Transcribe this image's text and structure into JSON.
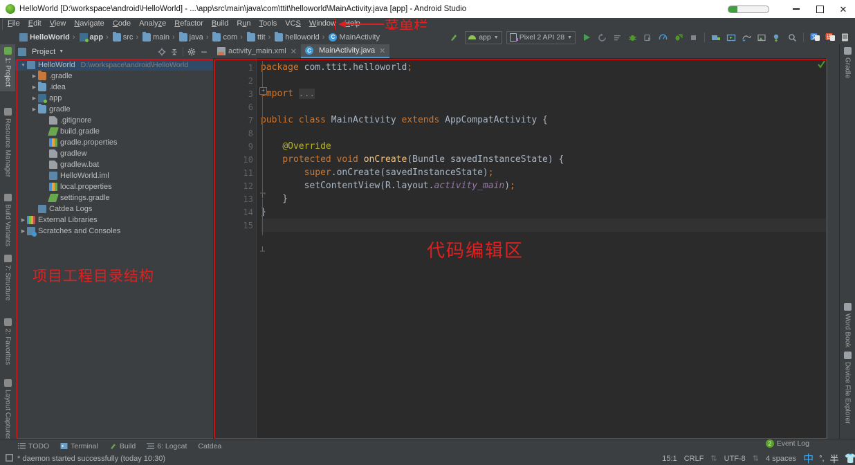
{
  "window": {
    "title": "HelloWorld [D:\\workspace\\android\\HelloWorld] - ...\\app\\src\\main\\java\\com\\ttit\\helloworld\\MainActivity.java [app] - Android Studio",
    "app_icon": "android-studio-icon",
    "minimize_label": "—",
    "maximize_label": "❐",
    "close_label": "✕",
    "progress_percent": 22
  },
  "menubar": {
    "items": [
      {
        "label": "File",
        "mnemonic": "F"
      },
      {
        "label": "Edit",
        "mnemonic": "E"
      },
      {
        "label": "View",
        "mnemonic": "V"
      },
      {
        "label": "Navigate",
        "mnemonic": "N"
      },
      {
        "label": "Code",
        "mnemonic": "C"
      },
      {
        "label": "Analyze",
        "mnemonic": "z"
      },
      {
        "label": "Refactor",
        "mnemonic": "R"
      },
      {
        "label": "Build",
        "mnemonic": "B"
      },
      {
        "label": "Run",
        "mnemonic": "u"
      },
      {
        "label": "Tools",
        "mnemonic": "T"
      },
      {
        "label": "VCS",
        "mnemonic": "S"
      },
      {
        "label": "Window",
        "mnemonic": "W"
      },
      {
        "label": "Help",
        "mnemonic": "H"
      }
    ]
  },
  "breadcrumb": {
    "items": [
      {
        "label": "HelloWorld",
        "icon": "project-icon",
        "bold": true
      },
      {
        "label": "app",
        "icon": "module-icon",
        "bold": true
      },
      {
        "label": "src",
        "icon": "folder-icon",
        "bold": false
      },
      {
        "label": "main",
        "icon": "folder-icon",
        "bold": false
      },
      {
        "label": "java",
        "icon": "folder-icon",
        "bold": false
      },
      {
        "label": "com",
        "icon": "package-icon",
        "bold": false
      },
      {
        "label": "ttit",
        "icon": "package-icon",
        "bold": false
      },
      {
        "label": "helloworld",
        "icon": "package-icon",
        "bold": false
      },
      {
        "label": "MainActivity",
        "icon": "class-icon",
        "bold": false
      }
    ],
    "separator": "›"
  },
  "toolbar": {
    "build_icon": "hammer-icon",
    "run_config": {
      "label": "app",
      "icon": "android-icon",
      "caret": "▼"
    },
    "device": {
      "label": "Pixel 2 API 28",
      "icon": "device-icon",
      "caret": "▼"
    },
    "actions": [
      {
        "name": "run-icon",
        "glyph": "▶"
      },
      {
        "name": "apply-changes-icon",
        "glyph": "⟲"
      },
      {
        "name": "apply-code-changes-icon",
        "glyph": "≡"
      },
      {
        "name": "debug-icon",
        "glyph": "🐞"
      },
      {
        "name": "attach-debugger-icon",
        "glyph": "⬓"
      },
      {
        "name": "profiler-icon",
        "glyph": "◔"
      },
      {
        "name": "run-with-coverage-icon",
        "glyph": "⬔"
      },
      {
        "name": "stop-icon",
        "glyph": "■"
      },
      {
        "name": "avd-manager-icon",
        "glyph": "▤"
      },
      {
        "name": "sdk-manager-icon",
        "glyph": "▣"
      },
      {
        "name": "sync-gradle-icon",
        "glyph": "⟳"
      },
      {
        "name": "project-structure-icon",
        "glyph": "◫"
      },
      {
        "name": "layout-inspector-icon",
        "glyph": "⬓"
      },
      {
        "name": "search-everywhere-icon",
        "glyph": "⌕"
      },
      {
        "name": "translate-icon-1",
        "glyph": "文"
      },
      {
        "name": "translate-icon-2",
        "glyph": "译"
      },
      {
        "name": "device-manager-icon",
        "glyph": "▯"
      }
    ]
  },
  "left_tool_strip": {
    "tabs": [
      {
        "label": "1: Project",
        "icon": "project-tool-icon",
        "active": true
      },
      {
        "label": "Resource Manager",
        "icon": "resource-manager-icon",
        "active": false
      },
      {
        "label": "Build Variants",
        "icon": "build-variants-icon",
        "active": false
      },
      {
        "label": "7: Structure",
        "icon": "structure-icon",
        "active": false
      },
      {
        "label": "2: Favorites",
        "icon": "favorites-star-icon",
        "active": false
      },
      {
        "label": "Layout Captures",
        "icon": "layout-captures-icon",
        "active": false
      }
    ]
  },
  "right_tool_strip": {
    "tabs": [
      {
        "label": "Gradle",
        "icon": "gradle-elephant-icon"
      },
      {
        "label": "Word Book",
        "icon": "word-book-icon"
      },
      {
        "label": "Device File Explorer",
        "icon": "device-file-explorer-icon"
      }
    ]
  },
  "project_panel": {
    "title": "Project",
    "title_icon": "project-view-icon",
    "caret": "▼",
    "header_actions": [
      {
        "name": "locate-icon",
        "glyph": "⊕"
      },
      {
        "name": "collapse-all-icon",
        "glyph": "⇱"
      },
      {
        "name": "settings-gear-icon",
        "glyph": "⚙"
      },
      {
        "name": "hide-panel-icon",
        "glyph": "—"
      }
    ],
    "tree": [
      {
        "label": "HelloWorld",
        "path": "D:\\workspace\\android\\HelloWorld",
        "indent": 0,
        "arrow": "▼",
        "icon": "project-icon",
        "selected": true
      },
      {
        "label": ".gradle",
        "path": "",
        "indent": 1,
        "arrow": "▶",
        "icon": "folder-orange-icon",
        "selected": false
      },
      {
        "label": ".idea",
        "path": "",
        "indent": 1,
        "arrow": "▶",
        "icon": "folder-icon",
        "selected": false
      },
      {
        "label": "app",
        "path": "",
        "indent": 1,
        "arrow": "▶",
        "icon": "module-icon",
        "selected": false
      },
      {
        "label": "gradle",
        "path": "",
        "indent": 1,
        "arrow": "▶",
        "icon": "folder-icon",
        "selected": false
      },
      {
        "label": ".gitignore",
        "path": "",
        "indent": 2,
        "arrow": "",
        "icon": "file-icon",
        "selected": false
      },
      {
        "label": "build.gradle",
        "path": "",
        "indent": 2,
        "arrow": "",
        "icon": "gradle-file-icon",
        "selected": false
      },
      {
        "label": "gradle.properties",
        "path": "",
        "indent": 2,
        "arrow": "",
        "icon": "properties-file-icon",
        "selected": false
      },
      {
        "label": "gradlew",
        "path": "",
        "indent": 2,
        "arrow": "",
        "icon": "file-icon",
        "selected": false
      },
      {
        "label": "gradlew.bat",
        "path": "",
        "indent": 2,
        "arrow": "",
        "icon": "file-icon",
        "selected": false
      },
      {
        "label": "HelloWorld.iml",
        "path": "",
        "indent": 2,
        "arrow": "",
        "icon": "iml-file-icon",
        "selected": false
      },
      {
        "label": "local.properties",
        "path": "",
        "indent": 2,
        "arrow": "",
        "icon": "properties-file-icon",
        "selected": false
      },
      {
        "label": "settings.gradle",
        "path": "",
        "indent": 2,
        "arrow": "",
        "icon": "gradle-file-icon",
        "selected": false
      },
      {
        "label": "Catdea Logs",
        "path": "",
        "indent": 1,
        "arrow": "",
        "icon": "catdea-logs-icon",
        "selected": false
      },
      {
        "label": "External Libraries",
        "path": "",
        "indent": 0,
        "arrow": "▶",
        "icon": "external-libraries-icon",
        "selected": false
      },
      {
        "label": "Scratches and Consoles",
        "path": "",
        "indent": 0,
        "arrow": "▶",
        "icon": "scratches-icon",
        "selected": false
      }
    ]
  },
  "editor": {
    "tabs": [
      {
        "label": "activity_main.xml",
        "icon": "xml-layout-icon",
        "active": false,
        "close": "✕"
      },
      {
        "label": "MainActivity.java",
        "icon": "java-class-icon",
        "active": true,
        "close": "✕"
      }
    ],
    "gutter_numbers": [
      "1",
      "2",
      "3",
      "6",
      "7",
      "8",
      "9",
      "10",
      "11",
      "12",
      "13",
      "14",
      "15"
    ],
    "lines": [
      {
        "num": "1",
        "text": "package com.ttit.helloworld;"
      },
      {
        "num": "2",
        "text": ""
      },
      {
        "num": "3",
        "text": "import ..."
      },
      {
        "num": "6",
        "text": ""
      },
      {
        "num": "7",
        "text": "public class MainActivity extends AppCompatActivity {"
      },
      {
        "num": "8",
        "text": ""
      },
      {
        "num": "9",
        "text": "    @Override"
      },
      {
        "num": "10",
        "text": "    protected void onCreate(Bundle savedInstanceState) {"
      },
      {
        "num": "11",
        "text": "        super.onCreate(savedInstanceState);"
      },
      {
        "num": "12",
        "text": "        setContentView(R.layout.activity_main);"
      },
      {
        "num": "13",
        "text": "    }"
      },
      {
        "num": "14",
        "text": "}"
      },
      {
        "num": "15",
        "text": ""
      }
    ]
  },
  "tool_window_bar": {
    "items": [
      {
        "label": "TODO",
        "icon": "todo-icon"
      },
      {
        "label": "Terminal",
        "icon": "terminal-icon"
      },
      {
        "label": "Build",
        "icon": "build-hammer-icon"
      },
      {
        "label": "6: Logcat",
        "icon": "logcat-icon"
      },
      {
        "label": "Catdea",
        "icon": ""
      }
    ],
    "event_log": {
      "label": "Event Log",
      "badge": "2"
    }
  },
  "statusbar": {
    "message": "* daemon started successfully (today 10:30)",
    "message_icon": "memory-indicator-icon",
    "caret_position": "15:1",
    "line_separator": "CRLF",
    "encoding": "UTF-8",
    "indent": "4 spaces",
    "right_icons": [
      {
        "name": "layout-editor-icon",
        "glyph": "中"
      },
      {
        "name": "ime-degree-icon",
        "glyph": "°,"
      },
      {
        "name": "ime-mode-icon",
        "glyph": "半"
      },
      {
        "name": "ime-tray-icon",
        "glyph": "👕"
      }
    ]
  },
  "annotations": [
    {
      "id": "menubar-annotation",
      "text": "菜单栏"
    },
    {
      "id": "project-tree-annotation",
      "text": "项目工程目录结构"
    },
    {
      "id": "code-editor-annotation",
      "text": "代码编辑区"
    }
  ],
  "colors": {
    "accent_red": "#e02020",
    "ide_bg": "#3c3f41",
    "editor_bg": "#2b2b2b",
    "selection_blue": "#2f4a66"
  }
}
